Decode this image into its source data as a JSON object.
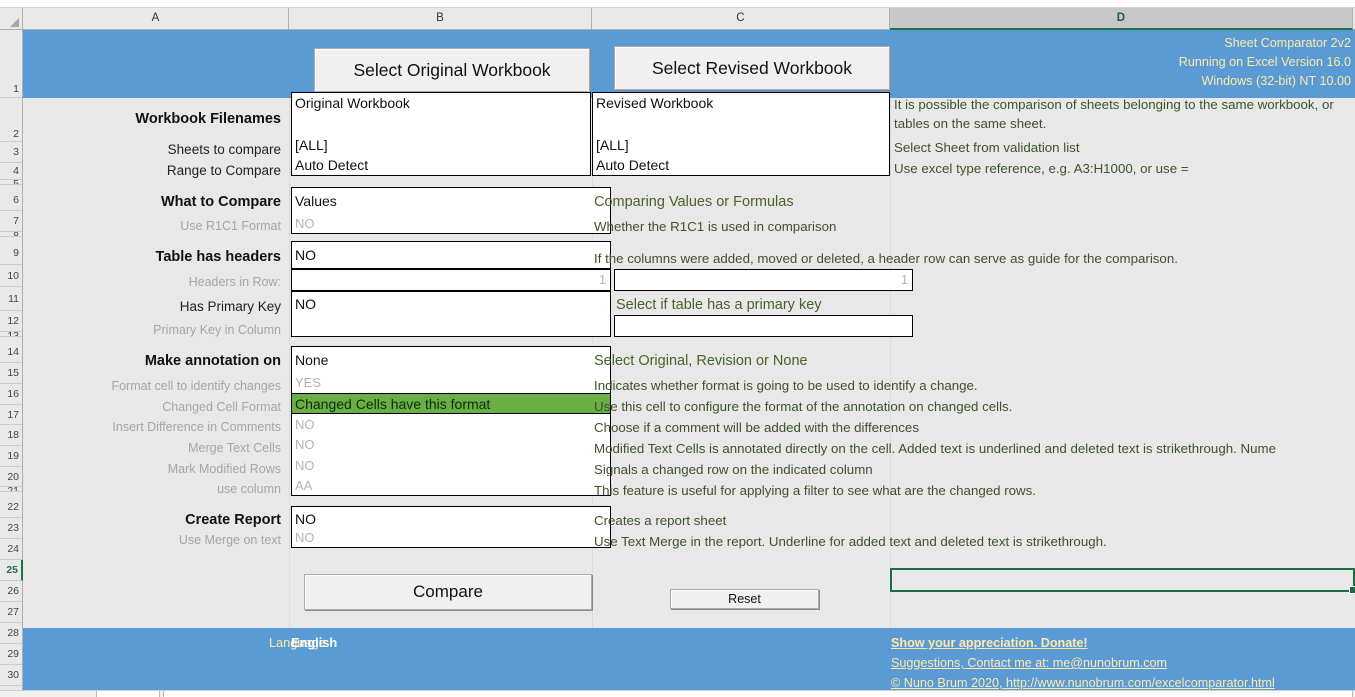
{
  "app": {
    "title": "Sheet Comparator 2v2",
    "excel_version": "Running on Excel Version 16.0",
    "os_version": "Windows (32-bit) NT 10.00"
  },
  "columns": [
    {
      "id": "A",
      "label": "A",
      "active": false
    },
    {
      "id": "B",
      "label": "B",
      "active": false
    },
    {
      "id": "C",
      "label": "C",
      "active": false
    },
    {
      "id": "D",
      "label": "D",
      "active": true
    }
  ],
  "rows": [
    {
      "n": "1",
      "active": false
    },
    {
      "n": "2",
      "active": false
    },
    {
      "n": "3",
      "active": false
    },
    {
      "n": "4",
      "active": false
    },
    {
      "n": "5",
      "active": false
    },
    {
      "n": "6",
      "active": false
    },
    {
      "n": "7",
      "active": false
    },
    {
      "n": "8",
      "active": false
    },
    {
      "n": "9",
      "active": false
    },
    {
      "n": "10",
      "active": false
    },
    {
      "n": "11",
      "active": false
    },
    {
      "n": "12",
      "active": false
    },
    {
      "n": "13",
      "active": false
    },
    {
      "n": "14",
      "active": false
    },
    {
      "n": "15",
      "active": false
    },
    {
      "n": "16",
      "active": false
    },
    {
      "n": "17",
      "active": false
    },
    {
      "n": "18",
      "active": false
    },
    {
      "n": "19",
      "active": false
    },
    {
      "n": "20",
      "active": false
    },
    {
      "n": "21",
      "active": false
    },
    {
      "n": "22",
      "active": false
    },
    {
      "n": "23",
      "active": false
    },
    {
      "n": "24",
      "active": false
    },
    {
      "n": "25",
      "active": true
    },
    {
      "n": "26",
      "active": false
    },
    {
      "n": "27",
      "active": false
    },
    {
      "n": "28",
      "active": false
    },
    {
      "n": "29",
      "active": false
    },
    {
      "n": "30",
      "active": false
    }
  ],
  "toolbar": {
    "select_original": "Select Original Workbook",
    "select_revised": "Select Revised Workbook"
  },
  "form": {
    "workbook_filenames": {
      "label": "Workbook Filenames",
      "original_value": "Original Workbook",
      "revised_value": "Revised Workbook",
      "description": "It is possible the comparison of sheets belonging to the same workbook, or tables on the same sheet."
    },
    "sheets_to_compare": {
      "label": "Sheets to compare",
      "original_value": "[ALL]",
      "revised_value": "[ALL]",
      "description": "Select Sheet from validation list"
    },
    "range_to_compare": {
      "label": "Range to Compare",
      "original_value": "Auto Detect",
      "revised_value": "Auto Detect",
      "description": "Use excel type reference, e.g. A3:H1000, or use ="
    },
    "what_to_compare": {
      "label": "What to Compare",
      "value": "Values",
      "description": "Comparing Values or Formulas"
    },
    "use_r1c1_format": {
      "label": "Use R1C1 Format",
      "value": "NO",
      "description": "Whether the R1C1 is used in comparison"
    },
    "table_has_headers": {
      "label": "Table has headers",
      "value": "NO",
      "description": "If the columns were added, moved or deleted, a header row can serve as guide for the comparison."
    },
    "headers_in_row": {
      "label": "Headers in Row:",
      "original_value": "1",
      "revised_value": "1",
      "description": ""
    },
    "has_primary_key": {
      "label": "Has Primary Key",
      "value": "NO",
      "description": "Select if table has a primary key"
    },
    "primary_key_in_column": {
      "label": "Primary Key in Column",
      "original_value": "",
      "revised_value": "",
      "description": ""
    },
    "make_annotation_on": {
      "label": "Make annotation on",
      "value": "None",
      "description": "Select Original, Revision or None"
    },
    "format_cell_to_identify_changes": {
      "label": "Format cell to identify changes",
      "value": "YES",
      "description": "Indicates whether format is going to be used to identify a change."
    },
    "changed_cell_format": {
      "label": "Changed Cell Format",
      "value": "Changed Cells have this format",
      "description": "Use this cell to configure the format of the annotation on changed cells."
    },
    "insert_difference_in_comments": {
      "label": "Insert Difference in Comments",
      "value": "NO",
      "description": "Choose if a comment will be added with the differences"
    },
    "merge_text_cells": {
      "label": "Merge Text Cells",
      "value": "NO",
      "description": "Modified Text Cells is annotated directly on the cell. Added text is underlined and deleted text is strikethrough. Nume"
    },
    "mark_modified_rows": {
      "label": "Mark Modified Rows",
      "value": "NO",
      "description": "Signals a changed row on the indicated column"
    },
    "use_column": {
      "label": "use column",
      "value": "AA",
      "description": "This feature is useful for applying a filter to see what are the changed rows."
    },
    "create_report": {
      "label": "Create Report",
      "value": "NO",
      "description": "Creates a report sheet"
    },
    "use_merge_on_text": {
      "label": "Use Merge on text",
      "value": "NO",
      "description": "Use Text Merge in the report. Underline for added text and deleted text is strikethrough."
    }
  },
  "actions": {
    "compare": "Compare",
    "reset": "Reset"
  },
  "footer": {
    "language_label": "Language :",
    "language_value": "English",
    "donate_link": "Show your appreciation. Donate!",
    "contact_link": "Suggestions, Contact me at: me@nunobrum.com",
    "copyright_link": "© Nuno Brum 2020, http://www.nunobrum.com/excelcomparator.html"
  },
  "theme": {
    "banner_blue": "#5b9bd5",
    "banner_text": "#ffe9a8",
    "desc_green": "#3d5229",
    "highlight_green": "#6aaf46",
    "selection_green": "#1d6b43",
    "grid_bg": "#e8e8e8"
  }
}
